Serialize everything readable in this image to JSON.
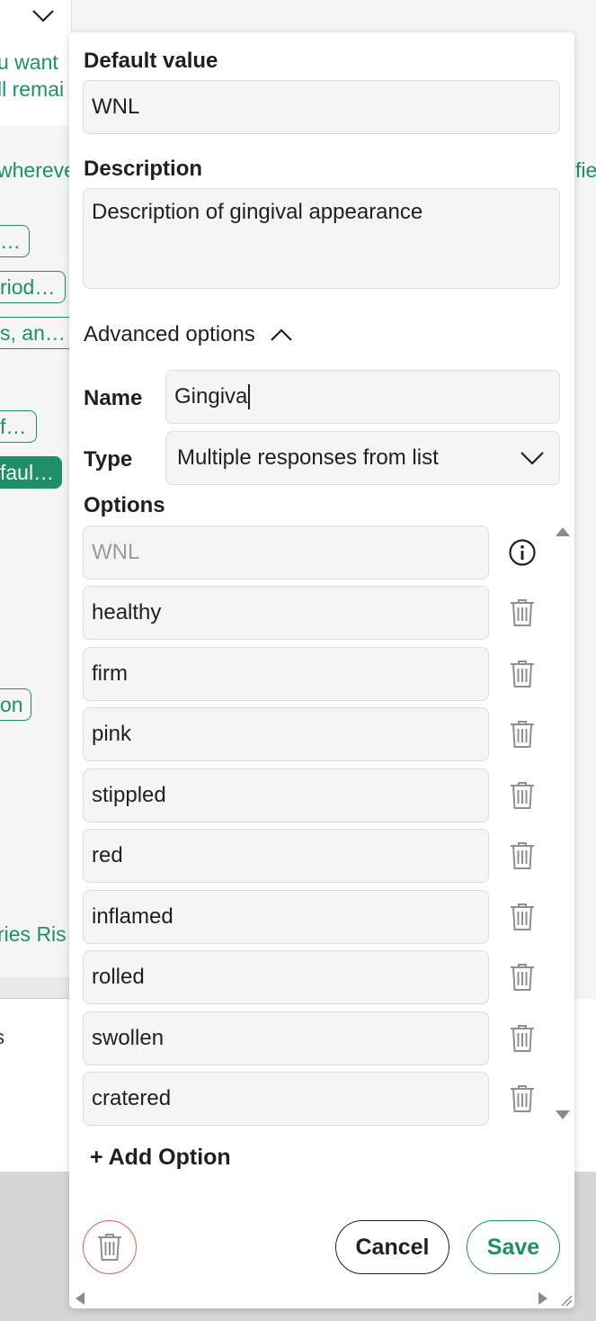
{
  "background": {
    "snippets": [
      "u want",
      "ll remai",
      "whereve",
      "fie"
    ],
    "tags": [
      "…",
      "riod…",
      "s, an…",
      "f…",
      "faul…",
      "on",
      "ries Ris"
    ],
    "lower_text": "s"
  },
  "panel": {
    "default_value": {
      "label": "Default value",
      "value": "WNL"
    },
    "description": {
      "label": "Description",
      "value": "Description of gingival appearance"
    },
    "advanced": {
      "label": "Advanced options"
    },
    "name": {
      "label": "Name",
      "value": "Gingiva"
    },
    "type": {
      "label": "Type",
      "value": "Multiple responses from list"
    },
    "options": {
      "label": "Options",
      "items": [
        "WNL",
        "healthy",
        "firm",
        "pink",
        "stippled",
        "red",
        "inflamed",
        "rolled",
        "swollen",
        "cratered"
      ]
    },
    "add_option_label": "+ Add Option",
    "cancel_label": "Cancel",
    "save_label": "Save"
  },
  "colors": {
    "accent": "#1f8f6a",
    "danger": "#e25b5b",
    "field_bg": "#f5f5f5",
    "icon_gray": "#8f8f8f"
  }
}
